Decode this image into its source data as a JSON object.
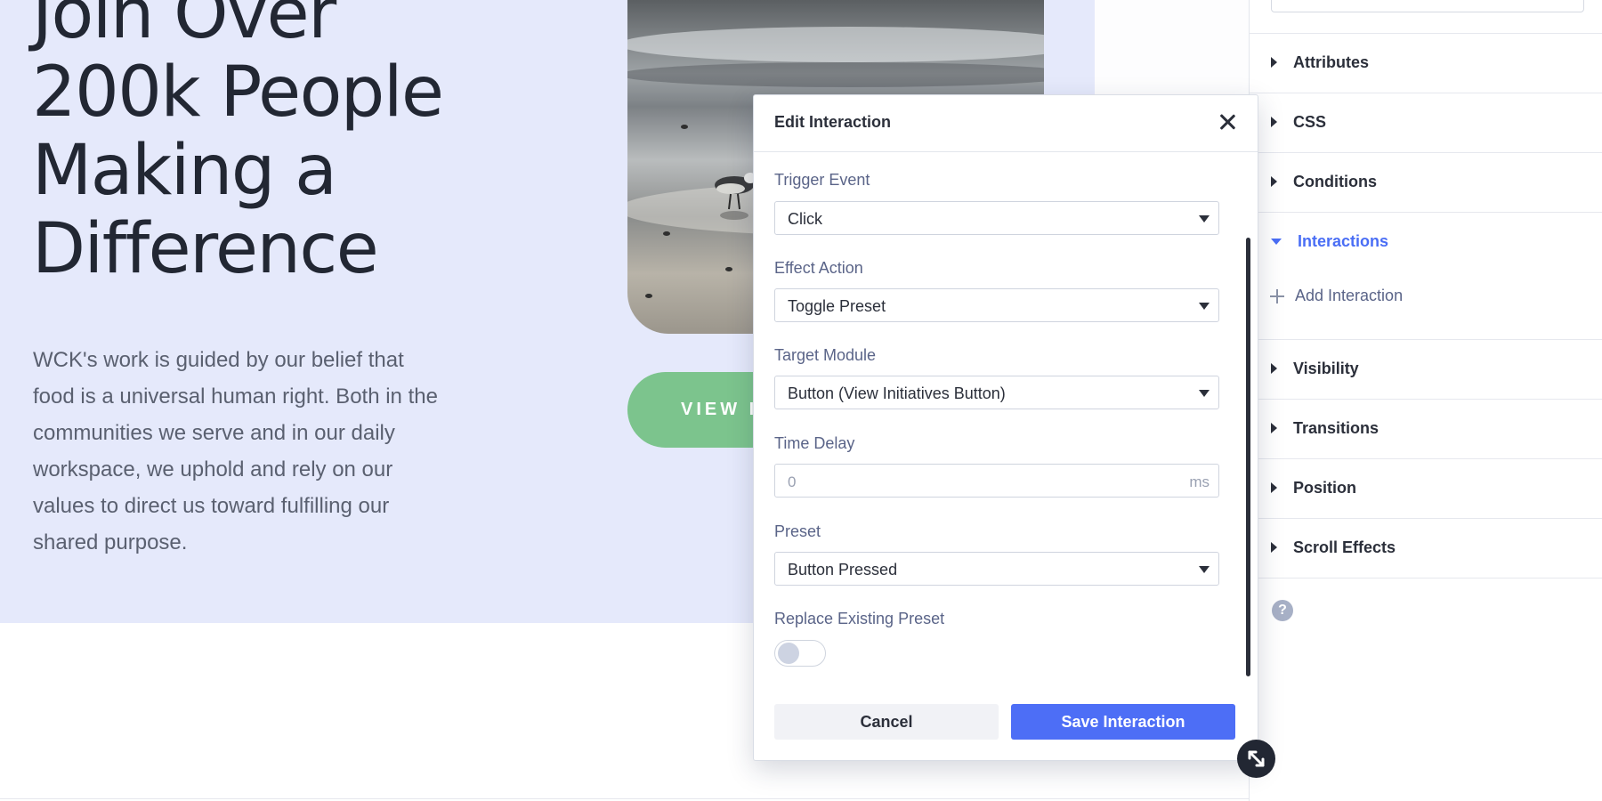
{
  "hero": {
    "title_lines": [
      "Join Over",
      "200k People",
      "Making a",
      "Difference"
    ],
    "body_lines": [
      "WCK's work is guided by our belief that",
      "food is a universal human right. Both in the",
      "communities we serve and in our daily",
      "workspace, we uphold and rely on our",
      "values to direct us toward fulfilling our",
      "shared purpose."
    ],
    "button_label": "VIEW INITIATIVES"
  },
  "settings_panel": {
    "sections": [
      {
        "label": "Attributes",
        "expanded": false
      },
      {
        "label": "CSS",
        "expanded": false
      },
      {
        "label": "Conditions",
        "expanded": false
      },
      {
        "label": "Interactions",
        "expanded": true
      },
      {
        "label": "Visibility",
        "expanded": false
      },
      {
        "label": "Transitions",
        "expanded": false
      },
      {
        "label": "Position",
        "expanded": false
      },
      {
        "label": "Scroll Effects",
        "expanded": false
      }
    ],
    "add_interaction_label": "Add Interaction",
    "help_glyph": "?",
    "accent_color": "#4a6ef5"
  },
  "modal": {
    "title": "Edit Interaction",
    "fields": {
      "trigger_event": {
        "label": "Trigger Event",
        "value": "Click"
      },
      "effect_action": {
        "label": "Effect Action",
        "value": "Toggle Preset"
      },
      "target_module": {
        "label": "Target Module",
        "value": "Button (View Initiatives Button)"
      },
      "time_delay": {
        "label": "Time Delay",
        "placeholder": "0",
        "unit": "ms"
      },
      "preset": {
        "label": "Preset",
        "value": "Button Pressed"
      },
      "replace_existing": {
        "label": "Replace Existing Preset",
        "enabled": false
      }
    },
    "cancel_label": "Cancel",
    "save_label": "Save Interaction",
    "primary_color": "#4d6ef6"
  },
  "icons": {
    "close": "close-icon",
    "resize": "resize-icon",
    "caret": "caret-down-icon",
    "plus": "plus-icon",
    "help": "help-icon"
  }
}
